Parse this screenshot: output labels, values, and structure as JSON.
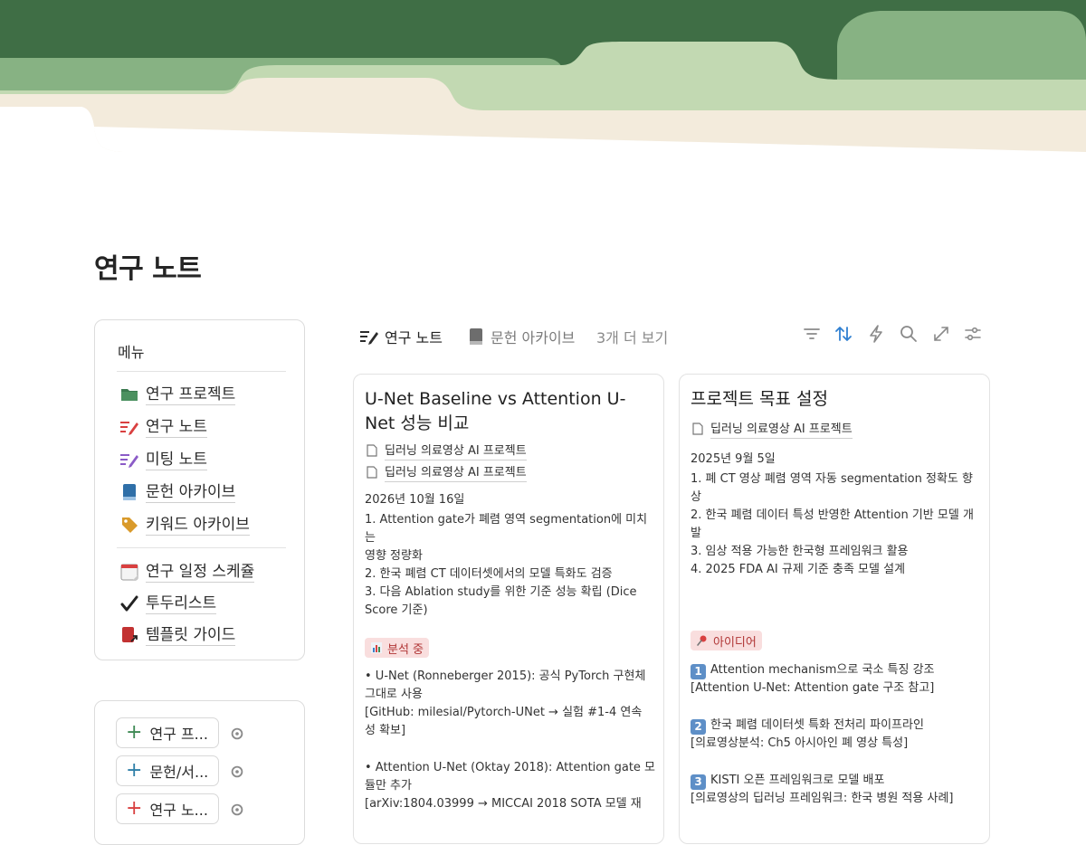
{
  "page": {
    "title": "연구 노트"
  },
  "menu": {
    "title": "메뉴",
    "items": [
      {
        "label": "연구 프로젝트",
        "icon": "folder-icon"
      },
      {
        "label": "연구 노트",
        "icon": "pen-icon"
      },
      {
        "label": "미팅 노트",
        "icon": "pen-icon"
      },
      {
        "label": "문헌 아카이브",
        "icon": "book-icon"
      },
      {
        "label": "키워드 아카이브",
        "icon": "tag-icon"
      },
      {
        "label": "연구 일정 스케쥴",
        "icon": "calendar-icon"
      },
      {
        "label": "투두리스트",
        "icon": "checkmark-icon"
      },
      {
        "label": "템플릿 가이드",
        "icon": "book-arrow-icon"
      }
    ]
  },
  "shortcuts": [
    {
      "label": "연구 프...",
      "color": "#3f8a55"
    },
    {
      "label": "문헌/서...",
      "color": "#2f7fa8"
    },
    {
      "label": "연구 노...",
      "color": "#d94040"
    }
  ],
  "views": {
    "tabs": [
      {
        "label": "연구 노트",
        "icon": "pen-icon",
        "active": true
      },
      {
        "label": "문헌 아카이브",
        "icon": "book-icon",
        "active": false
      }
    ],
    "more_label": "3개 더 보기",
    "toolbar": [
      "filter-icon",
      "sort-icon",
      "automation-icon",
      "search-icon",
      "expand-icon",
      "settings-icon"
    ]
  },
  "cards": [
    {
      "title": "U-Net Baseline vs Attention U-Net 성능 비교",
      "relations": [
        "딥러닝 의료영상 AI 프로젝트",
        "딥러닝 의료영상 AI 프로젝트"
      ],
      "date": "2026년 10월 16일",
      "goals": [
        "1. Attention gate가 폐렴 영역 segmentation에 미치는",
        "영향 정량화",
        "2. 한국 폐렴 CT 데이터셋에서의 모델 특화도 검증",
        "3. 다음 Ablation study를 위한 기준 성능 확립 (Dice",
        "Score 기준)"
      ],
      "tag": {
        "label": "분석 중",
        "icon": "bar-chart-icon",
        "bg": "#f9dede",
        "color": "#b03535"
      },
      "notes": [
        "• U-Net (Ronneberger 2015): 공식 PyTorch 구현체",
        "그대로 사용",
        "[GitHub: milesial/Pytorch-UNet → 실험 #1-4 연속",
        "성 확보]",
        "",
        "• Attention U-Net (Oktay 2018): Attention gate 모",
        "듈만 추가",
        "[arXiv:1804.03999 → MICCAI 2018 SOTA 모델 재"
      ]
    },
    {
      "title": "프로젝트 목표 설정",
      "relations": [
        "딥러닝 의료영상 AI 프로젝트"
      ],
      "date": "2025년 9월 5일",
      "goals": [
        "1. 폐 CT 영상 폐렴 영역 자동 segmentation 정확도 향상",
        "2. 한국 폐렴 데이터 특성 반영한 Attention 기반 모델 개발",
        "3. 임상 적용 가능한 한국형 프레임워크 활용",
        "4. 2025 FDA AI 규제 기준 충족 모델 설계"
      ],
      "tag": {
        "label": "아이디어",
        "icon": "pushpin-icon",
        "bg": "#f9dede",
        "color": "#b03535"
      },
      "ideas": [
        {
          "num": "1",
          "text": "Attention mechanism으로 국소 특징 강조",
          "ref": "[Attention U-Net: Attention gate 구조 참고]"
        },
        {
          "num": "2",
          "text": "한국 폐렴 데이터셋 특화 전처리 파이프라인",
          "ref": "[의료영상분석: Ch5 아시아인 폐 영상 특성]"
        },
        {
          "num": "3",
          "text": "KISTI 오픈 프레임워크로 모델 배포",
          "ref": "[의료영상의 딥러닝 프레임워크: 한국 병원 적용 사례]"
        }
      ]
    }
  ]
}
